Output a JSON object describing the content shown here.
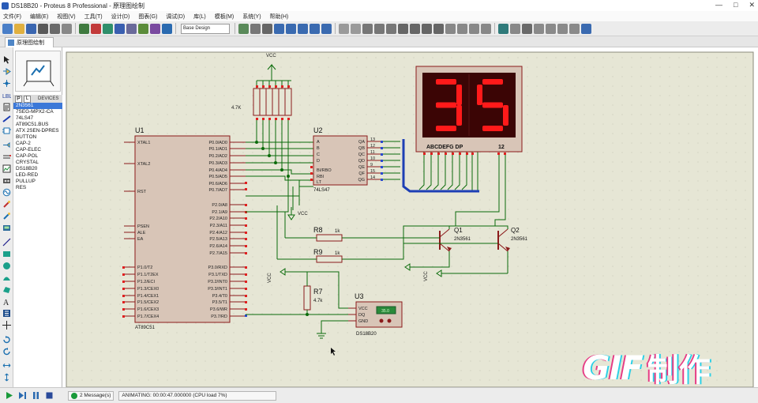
{
  "window": {
    "title": "DS18B20 - Proteus 8 Professional - 原理图绘制",
    "controls": [
      "—",
      "□",
      "✕"
    ]
  },
  "menu": [
    "文件(F)",
    "编辑(E)",
    "视图(V)",
    "工具(T)",
    "设计(D)",
    "图表(G)",
    "调试(D)",
    "库(L)",
    "模板(M)",
    "系统(Y)",
    "帮助(H)"
  ],
  "toolbar": {
    "design_select": "Base Design"
  },
  "tab": {
    "label": "原理图绘制"
  },
  "devices": {
    "header": "DEVICES",
    "items": [
      "2N3561",
      "7SEG-MPX2-CA",
      "74LS47",
      "AT89C51.BUS",
      "ATX 2SEN-DPRES",
      "BUTTON",
      "CAP-2",
      "CAP-ELEC",
      "CAP-POL",
      "CRYSTAL",
      "DS18B20",
      "LED-RED",
      "PULLUP",
      "RES"
    ],
    "selected_index": 0
  },
  "schematic": {
    "u1": {
      "ref": "U1",
      "part": "AT89C51",
      "pins_left": [
        "XTAL1",
        "XTAL2",
        "RST",
        "PSEN",
        "ALE",
        "EA",
        "P1.0/T2",
        "P1.1/T2EX",
        "P1.2/ECI",
        "P1.3/CEX0",
        "P1.4/CEX1",
        "P1.5/CEX2",
        "P1.6/CEX3",
        "P1.7/CEX4"
      ],
      "pins_right": [
        "P0.0/AD0",
        "P0.1/AD1",
        "P0.2/AD2",
        "P0.3/AD3",
        "P0.4/AD4",
        "P0.5/AD5",
        "P0.6/AD6",
        "P0.7/AD7",
        "P2.0/A8",
        "P2.1/A9",
        "P2.2/A10",
        "P2.3/A11",
        "P2.4/A12",
        "P2.5/A13",
        "P2.6/A14",
        "P2.7/A15",
        "P3.0/RXD",
        "P3.1/TXD",
        "P3.2/INT0",
        "P3.3/INT1",
        "P3.4/T0",
        "P3.5/T1",
        "P3.6/WR",
        "P3.7/RD"
      ]
    },
    "u2": {
      "ref": "U2",
      "part": "74LS47",
      "pins_left": [
        "A",
        "B",
        "C",
        "D",
        "BI/RBO",
        "RBI",
        "LT"
      ],
      "pins_right": [
        "QA",
        "QB",
        "QC",
        "QD",
        "QE",
        "QF",
        "QG"
      ]
    },
    "u3": {
      "ref": "U3",
      "part": "DS18B20",
      "pins": [
        "VCC",
        "DQ",
        "GND"
      ],
      "temp": "35.0"
    },
    "display": {
      "digits": "35",
      "label": "ABCDEFG  DP",
      "common": "12"
    },
    "resistors": {
      "rn": "4.7K",
      "r7": "R7",
      "r7_value": "4.7k",
      "r8": "R8",
      "r8_value": "1k",
      "r9": "R9",
      "r9_value": "1k"
    },
    "transistors": {
      "q1": "Q1",
      "q1_part": "2N3561",
      "q2": "Q2",
      "q2_part": "2N3561"
    },
    "power": {
      "vcc": "VCC"
    }
  },
  "status": {
    "messages": "2 Message(s)",
    "animating": "ANIMATING: 00:00:47.000000 (CPU load 7%)"
  },
  "watermark": {
    "gif": "GIF",
    "cn": "制作"
  },
  "colors": {
    "canvas_bg": "#ffffff",
    "sheet_bg": "#e6e6d5",
    "wire": "#0a6b0a",
    "bus": "#1d3fb5",
    "component": "#8b1a1a",
    "chip_fill": "#d8c5b7",
    "seg_on": "#ff1a1a",
    "display_bg": "#3b0505"
  }
}
